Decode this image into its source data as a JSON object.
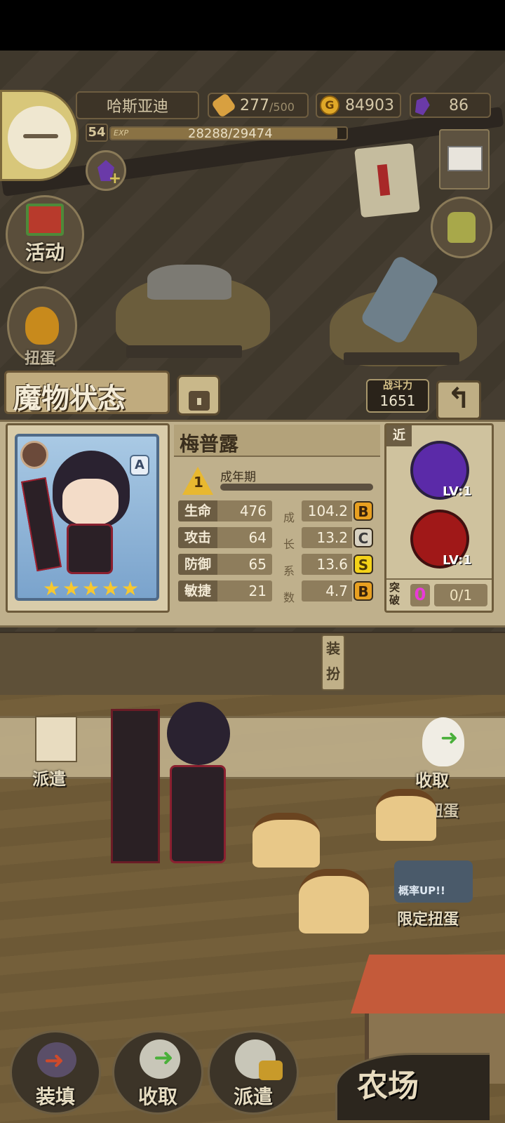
{
  "hud": {
    "player_name": "哈斯亚迪",
    "level": "54",
    "exp_label": "EXP",
    "exp_text": "28288/29474",
    "exp_fraction": 0.96,
    "stamina_current": "277",
    "stamina_max": "/500",
    "gold": "84903",
    "gems": "86"
  },
  "side_menu": {
    "activity_label": "活动",
    "gacha_partial": "扭蛋"
  },
  "status": {
    "title": "魔物状态",
    "power_label": "战斗力",
    "power_value": "1651"
  },
  "monster": {
    "name": "梅普露",
    "rank_badge": "A",
    "stars": 5,
    "stage_number": "1",
    "stage_label": "成年期",
    "growth_caption": [
      "成",
      "长",
      "系",
      "数"
    ],
    "stats": [
      {
        "name": "生命",
        "value": "476",
        "growth": "104.2",
        "grade": "B"
      },
      {
        "name": "攻击",
        "value": "64",
        "growth": "13.2",
        "grade": "C"
      },
      {
        "name": "防御",
        "value": "65",
        "growth": "13.6",
        "grade": "S"
      },
      {
        "name": "敏捷",
        "value": "21",
        "growth": "4.7",
        "grade": "B"
      }
    ],
    "range_tag": "近",
    "skills": [
      {
        "level": "LV:1",
        "color": "#5b2aa8"
      },
      {
        "level": "LV:1",
        "color": "#a01818"
      }
    ],
    "breakthrough_label": "突破",
    "breakthrough_count": "0",
    "breakthrough_progress": "0/1"
  },
  "dress_up_label": "装扮",
  "farm_actions": {
    "dispatch_label": "派遣",
    "collect_label": "收取",
    "limited_gacha_1": "限定扭蛋",
    "limited_gacha_2": "限定扭蛋",
    "rate_up": "概率UP!!"
  },
  "bottom_nav": {
    "load_label": "装填",
    "collect_label": "收取",
    "dispatch_label": "派遣",
    "farm_label": "农场"
  }
}
